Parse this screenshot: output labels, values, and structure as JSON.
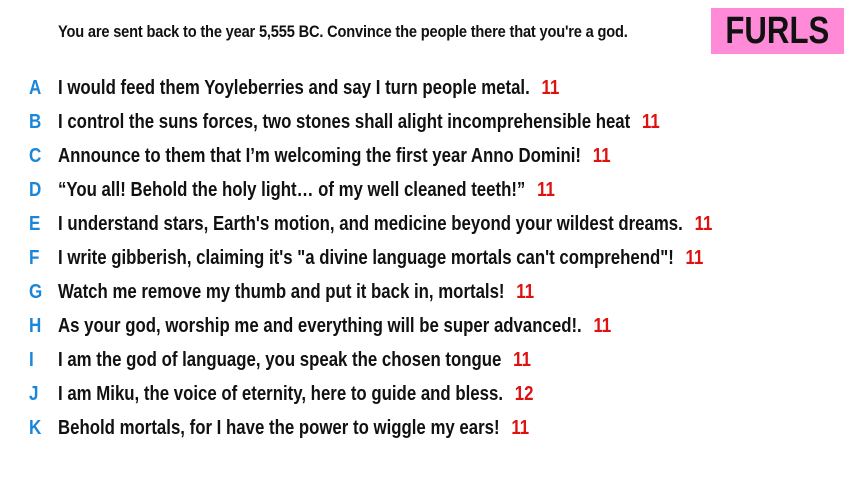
{
  "prompt": "You are sent back to the year 5,555 BC. Convince the people there that you're a god.",
  "badge": {
    "label": "FURLS",
    "color": "#ff8ad8"
  },
  "colors": {
    "letter": "#1a86d9",
    "score": "#e01010"
  },
  "answers": [
    {
      "letter": "A",
      "text": "I would feed them Yoyleberries and say I turn people metal.",
      "score": "11"
    },
    {
      "letter": "B",
      "text": "I control the suns forces, two stones shall alight incomprehensible heat",
      "score": "11"
    },
    {
      "letter": "C",
      "text": "Announce to them that I’m welcoming the first year Anno Domini!",
      "score": "11"
    },
    {
      "letter": "D",
      "text": "“You all! Behold the holy light… of my well cleaned teeth!”",
      "score": "11"
    },
    {
      "letter": "E",
      "text": "I understand stars, Earth's motion, and medicine beyond your wildest dreams.",
      "score": "11"
    },
    {
      "letter": "F",
      "text": "I write gibberish, claiming it's \"a divine language mortals can't comprehend\"!",
      "score": "11"
    },
    {
      "letter": "G",
      "text": "Watch me remove my thumb and put it back in, mortals!",
      "score": "11"
    },
    {
      "letter": "H",
      "text": "As your god, worship me and everything will be super advanced!.",
      "score": "11"
    },
    {
      "letter": "I",
      "text": "I am the god of language, you speak the chosen tongue",
      "score": "11"
    },
    {
      "letter": "J",
      "text": "I am Miku, the voice of eternity, here to guide and bless.",
      "score": "12"
    },
    {
      "letter": "K",
      "text": "Behold mortals, for I have the power to wiggle my ears!",
      "score": "11"
    }
  ]
}
